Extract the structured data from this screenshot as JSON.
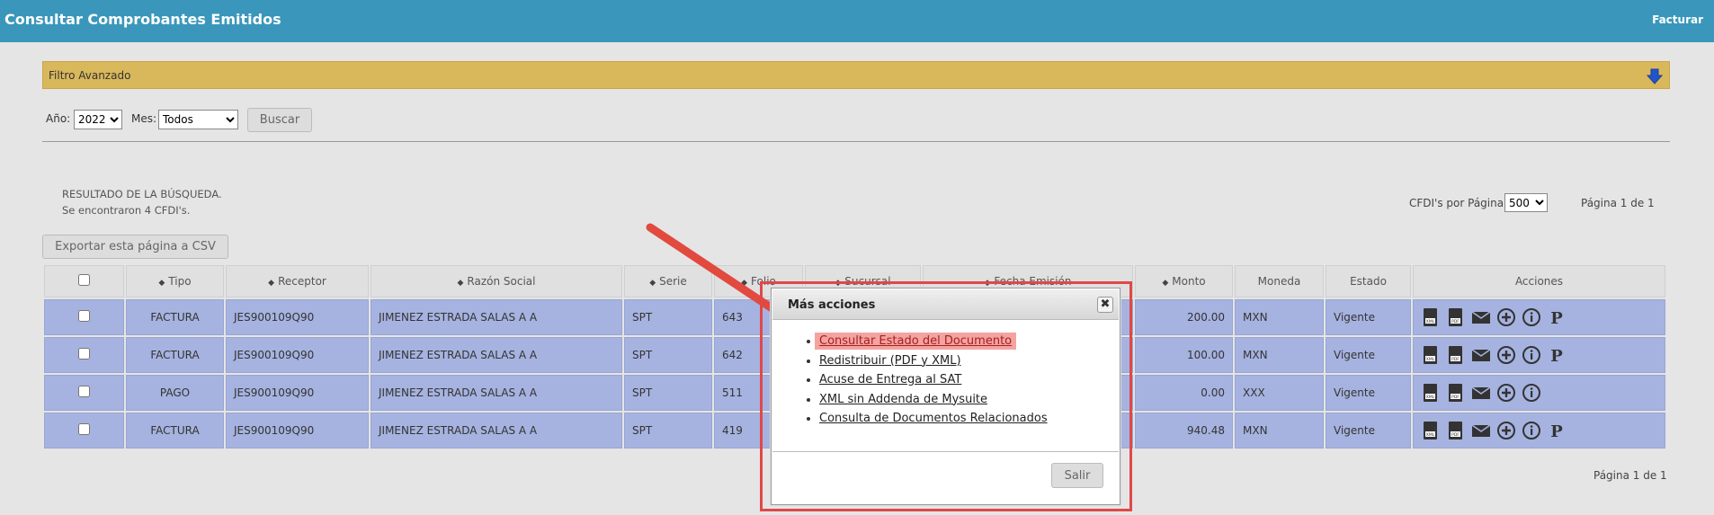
{
  "header": {
    "title": "Consultar Comprobantes Emitidos",
    "facturar": "Facturar"
  },
  "filter": {
    "label": "Filtro Avanzado"
  },
  "search": {
    "year_label": "Año:",
    "year_value": "2022",
    "month_label": "Mes:",
    "month_value": "Todos",
    "button": "Buscar"
  },
  "results": {
    "line1": "RESULTADO DE LA BÚSQUEDA.",
    "line2": "Se encontraron 4 CFDI's.",
    "per_page_label": "CFDI's por Página:",
    "per_page_value": "500",
    "page_top": "Página 1 de 1",
    "page_bottom": "Página 1 de 1",
    "export_button": "Exportar esta página a CSV"
  },
  "table": {
    "headers": {
      "tipo": "Tipo",
      "receptor": "Receptor",
      "razon": "Razón Social",
      "serie": "Serie",
      "folio": "Folio",
      "sucursal": "Sucursal",
      "fecha": "Fecha Emisión",
      "monto": "Monto",
      "moneda": "Moneda",
      "estado": "Estado",
      "acciones": "Acciones"
    },
    "rows": [
      {
        "tipo": "FACTURA",
        "receptor": "JES900109Q90",
        "razon": "JIMENEZ ESTRADA SALAS A A",
        "serie": "SPT",
        "folio": "643",
        "monto": "200.00",
        "moneda": "MXN",
        "estado": "Vigente"
      },
      {
        "tipo": "FACTURA",
        "receptor": "JES900109Q90",
        "razon": "JIMENEZ ESTRADA SALAS A A",
        "serie": "SPT",
        "folio": "642",
        "monto": "100.00",
        "moneda": "MXN",
        "estado": "Vigente"
      },
      {
        "tipo": "PAGO",
        "receptor": "JES900109Q90",
        "razon": "JIMENEZ ESTRADA SALAS A A",
        "serie": "SPT",
        "folio": "511",
        "monto": "0.00",
        "moneda": "XXX",
        "estado": "Vigente"
      },
      {
        "tipo": "FACTURA",
        "receptor": "JES900109Q90",
        "razon": "JIMENEZ ESTRADA SALAS A A",
        "serie": "SPT",
        "folio": "419",
        "monto": "940.48",
        "moneda": "MXN",
        "estado": "Vigente"
      }
    ]
  },
  "dialog": {
    "title": "Más acciones",
    "close": "✖",
    "items": [
      "Consultar Estado del Documento",
      "Redistribuir (PDF y XML)",
      "Acuse de Entrega al SAT",
      "XML sin Addenda de Mysuite",
      "Consulta de Documentos Relacionados"
    ],
    "exit": "Salir"
  },
  "icons": [
    "xml-download-icon",
    "pdf-download-icon",
    "email-icon",
    "add-icon",
    "info-icon",
    "p-icon"
  ],
  "colors": {
    "header": "#3a97bb",
    "filter": "#d9b75b",
    "row": "#a6b3e0",
    "highlight": "#e04848"
  }
}
